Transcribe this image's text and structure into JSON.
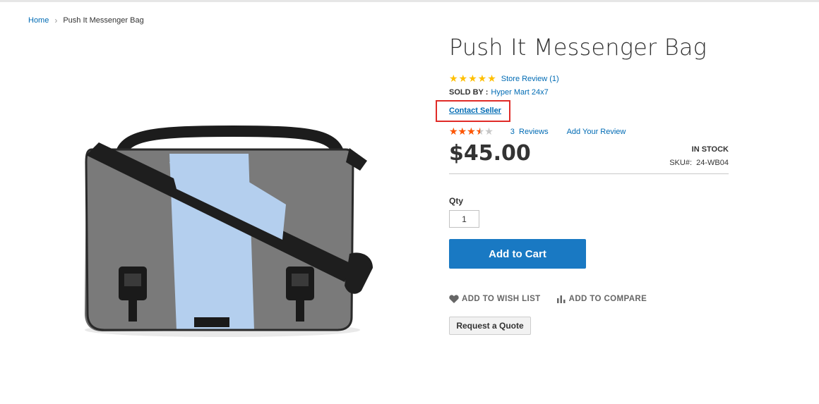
{
  "breadcrumb": {
    "home": "Home",
    "current": "Push It Messenger Bag"
  },
  "product": {
    "title": "Push It Messenger Bag",
    "store_review": "Store Review (1)",
    "sold_by_label": "SOLD BY :",
    "seller_name": "Hyper Mart 24x7",
    "contact_seller": "Contact Seller",
    "rating_fraction": 0.7,
    "review_count": "3",
    "reviews_label": "Reviews",
    "add_review": "Add Your Review",
    "price": "$45.00",
    "stock": "IN STOCK",
    "sku_label": "SKU#:",
    "sku": "24-WB04",
    "qty_label": "Qty",
    "qty_value": "1",
    "add_to_cart": "Add to Cart",
    "wish_list": "ADD TO WISH LIST",
    "compare": "ADD TO COMPARE",
    "request_quote": "Request a Quote"
  },
  "colors": {
    "link": "#006bb4",
    "primary": "#1979c3",
    "star_gold": "#ffbf00",
    "star_red": "#ff5501",
    "highlight": "#e02b27"
  },
  "icons": [
    "heart-icon",
    "compare-icon",
    "star-icon",
    "chevron-right-icon"
  ]
}
